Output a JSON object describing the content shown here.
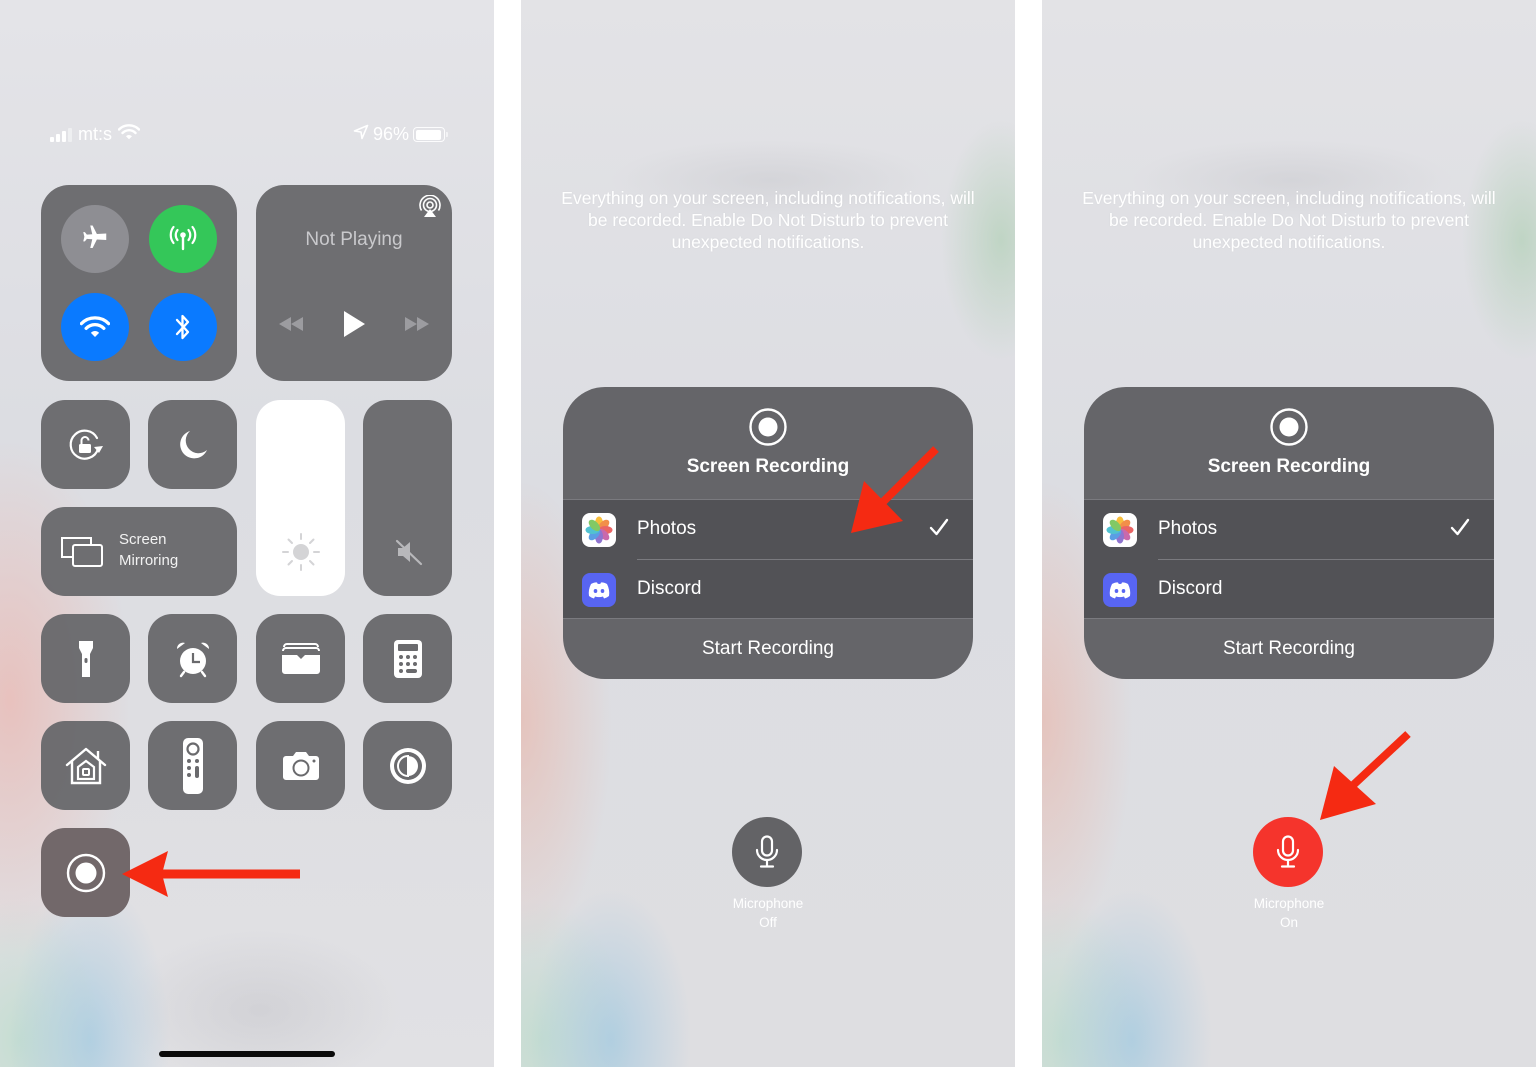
{
  "panels": {
    "control_center": {
      "status_bar": {
        "carrier": "mt:s",
        "battery_percent": "96%",
        "battery_level": 0.96,
        "signal_bars_active": 3,
        "signal_bars_total": 4,
        "icons": [
          "cellular-signal-icon",
          "wifi-icon",
          "location-arrow-icon",
          "battery-icon"
        ]
      },
      "connectivity": {
        "airplane_mode": {
          "icon": "airplane-icon",
          "state": "off",
          "color": "#8e8e93"
        },
        "cellular_data": {
          "icon": "antenna-icon",
          "state": "on",
          "color": "#34c759"
        },
        "wifi": {
          "icon": "wifi-icon",
          "state": "on",
          "color": "#0a7aff"
        },
        "bluetooth": {
          "icon": "bluetooth-icon",
          "state": "on",
          "color": "#0a7aff"
        }
      },
      "now_playing": {
        "title": "Not Playing",
        "icons": [
          "airplay-audio-icon",
          "rewind-icon",
          "play-icon",
          "fast-forward-icon"
        ]
      },
      "toggles": {
        "orientation_lock": "rotation-lock-icon",
        "do_not_disturb": "moon-icon"
      },
      "screen_mirroring": {
        "line1": "Screen",
        "line2": "Mirroring"
      },
      "brightness_level": 1.0,
      "volume_level": 0.0,
      "volume_icon": "speaker-muted-icon",
      "shortcut_tiles": [
        "flashlight-icon",
        "alarm-clock-icon",
        "wallet-icon",
        "calculator-icon",
        "home-icon",
        "apple-tv-remote-icon",
        "camera-icon",
        "dark-mode-icon"
      ],
      "screen_record_tile": "screen-record-icon"
    },
    "recording_sheet_mic_off": {
      "warning": "Everything on your screen, including notifications, will be recorded. Enable Do Not Disturb to prevent unexpected notifications.",
      "sheet_title": "Screen Recording",
      "destinations": [
        {
          "label": "Photos",
          "selected": true,
          "icon": "photos-app-icon"
        },
        {
          "label": "Discord",
          "selected": false,
          "icon": "discord-app-icon"
        }
      ],
      "start_label": "Start Recording",
      "microphone": {
        "line1": "Microphone",
        "line2": "Off",
        "state": "off",
        "color": "#636366"
      }
    },
    "recording_sheet_mic_on": {
      "warning": "Everything on your screen, including notifications, will be recorded. Enable Do Not Disturb to prevent unexpected notifications.",
      "sheet_title": "Screen Recording",
      "destinations": [
        {
          "label": "Photos",
          "selected": true,
          "icon": "photos-app-icon"
        },
        {
          "label": "Discord",
          "selected": false,
          "icon": "discord-app-icon"
        }
      ],
      "start_label": "Start Recording",
      "microphone": {
        "line1": "Microphone",
        "line2": "On",
        "state": "on",
        "color": "#f5342c"
      }
    }
  },
  "annotation_color": "#f52a12"
}
